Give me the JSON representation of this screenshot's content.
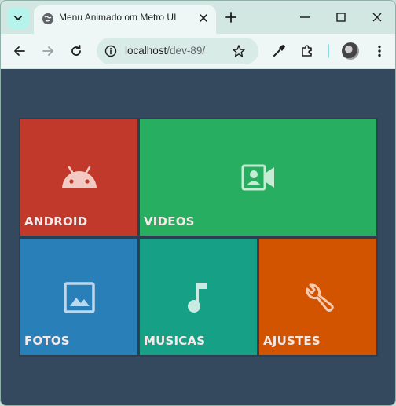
{
  "browser": {
    "tab_title": "Menu Animado om Metro UI",
    "url_host": "localhost",
    "url_path": "/dev-89/"
  },
  "tiles": [
    {
      "label": "ANDROID",
      "color": "#c0392b",
      "icon": "android-icon"
    },
    {
      "label": "VIDEOS",
      "color": "#27ae60",
      "icon": "video-contact-icon"
    },
    {
      "label": "FOTOS",
      "color": "#2980b9",
      "icon": "image-icon"
    },
    {
      "label": "MUSICAS",
      "color": "#16a085",
      "icon": "music-note-icon"
    },
    {
      "label": "AJUSTES",
      "color": "#d35400",
      "icon": "wrench-icon"
    }
  ],
  "colors": {
    "page_background": "#34495e",
    "tile_border": "#2c3e50"
  }
}
